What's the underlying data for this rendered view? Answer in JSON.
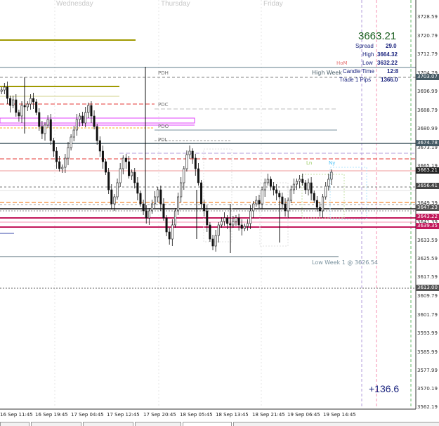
{
  "window": {
    "title": ""
  },
  "day_labels": [
    "Wednesday",
    "Thursday",
    "Friday"
  ],
  "price_axis": {
    "ticks": [
      "3728.59",
      "3720.79",
      "3712.79",
      "3704.79",
      "3696.99",
      "3688.79",
      "3680.99",
      "3673.19",
      "3665.19",
      "3657.19",
      "3649.39",
      "3641.39",
      "3633.59",
      "3625.59",
      "3617.59",
      "3609.79",
      "3601.79",
      "3593.99",
      "3585.99",
      "3577.99",
      "3570.19",
      "3562.19"
    ],
    "tags": [
      {
        "text": "3703.07",
        "color": "#455a64"
      },
      {
        "text": "3674.78",
        "color": "#455a64"
      },
      {
        "text": "3663.21",
        "color": "#222222"
      },
      {
        "text": "3656.41",
        "color": "#444444"
      },
      {
        "text": "3647.23",
        "color": "#555555"
      },
      {
        "text": "3643.22",
        "color": "#c2185b"
      },
      {
        "text": "3639.35",
        "color": "#c2185b"
      },
      {
        "text": "3613.00",
        "color": "#555555"
      }
    ]
  },
  "time_axis": {
    "ticks": [
      "16 Sep 11:45",
      "16 Sep 19:45",
      "17 Sep 04:45",
      "17 Sep 12:45",
      "17 Sep 20:45",
      "18 Sep 05:45",
      "18 Sep 13:45",
      "18 Sep 21:45",
      "19 Sep 06:45",
      "19 Sep 14:45"
    ]
  },
  "info_panel": {
    "price": "3663.21",
    "spread_label": "Spread",
    "spread_value": "29.0",
    "high_label": "High",
    "high_value": "3664.32",
    "low_label": "Low",
    "low_value": "3632.22",
    "candle_time_label": "Candle Time",
    "candle_time_value": "12:8",
    "trade_pips_label": "Trade 1 Pips",
    "trade_pips_value": "1366.0"
  },
  "level_labels": {
    "pdh": "PDH",
    "pdc": "PDC",
    "pdo": "PDO",
    "pdl": "PDL",
    "hom": "HoM",
    "high_week": "High Week",
    "low_week": "Low Week 1 @ 3626.54",
    "ln": "Ln",
    "ny": "Ny"
  },
  "pnl": "+136.6",
  "colors": {
    "info_price": "#1b5e20",
    "pnl": "#1a237e",
    "magenta": "#c2185b",
    "olive": "#a09a00"
  }
}
